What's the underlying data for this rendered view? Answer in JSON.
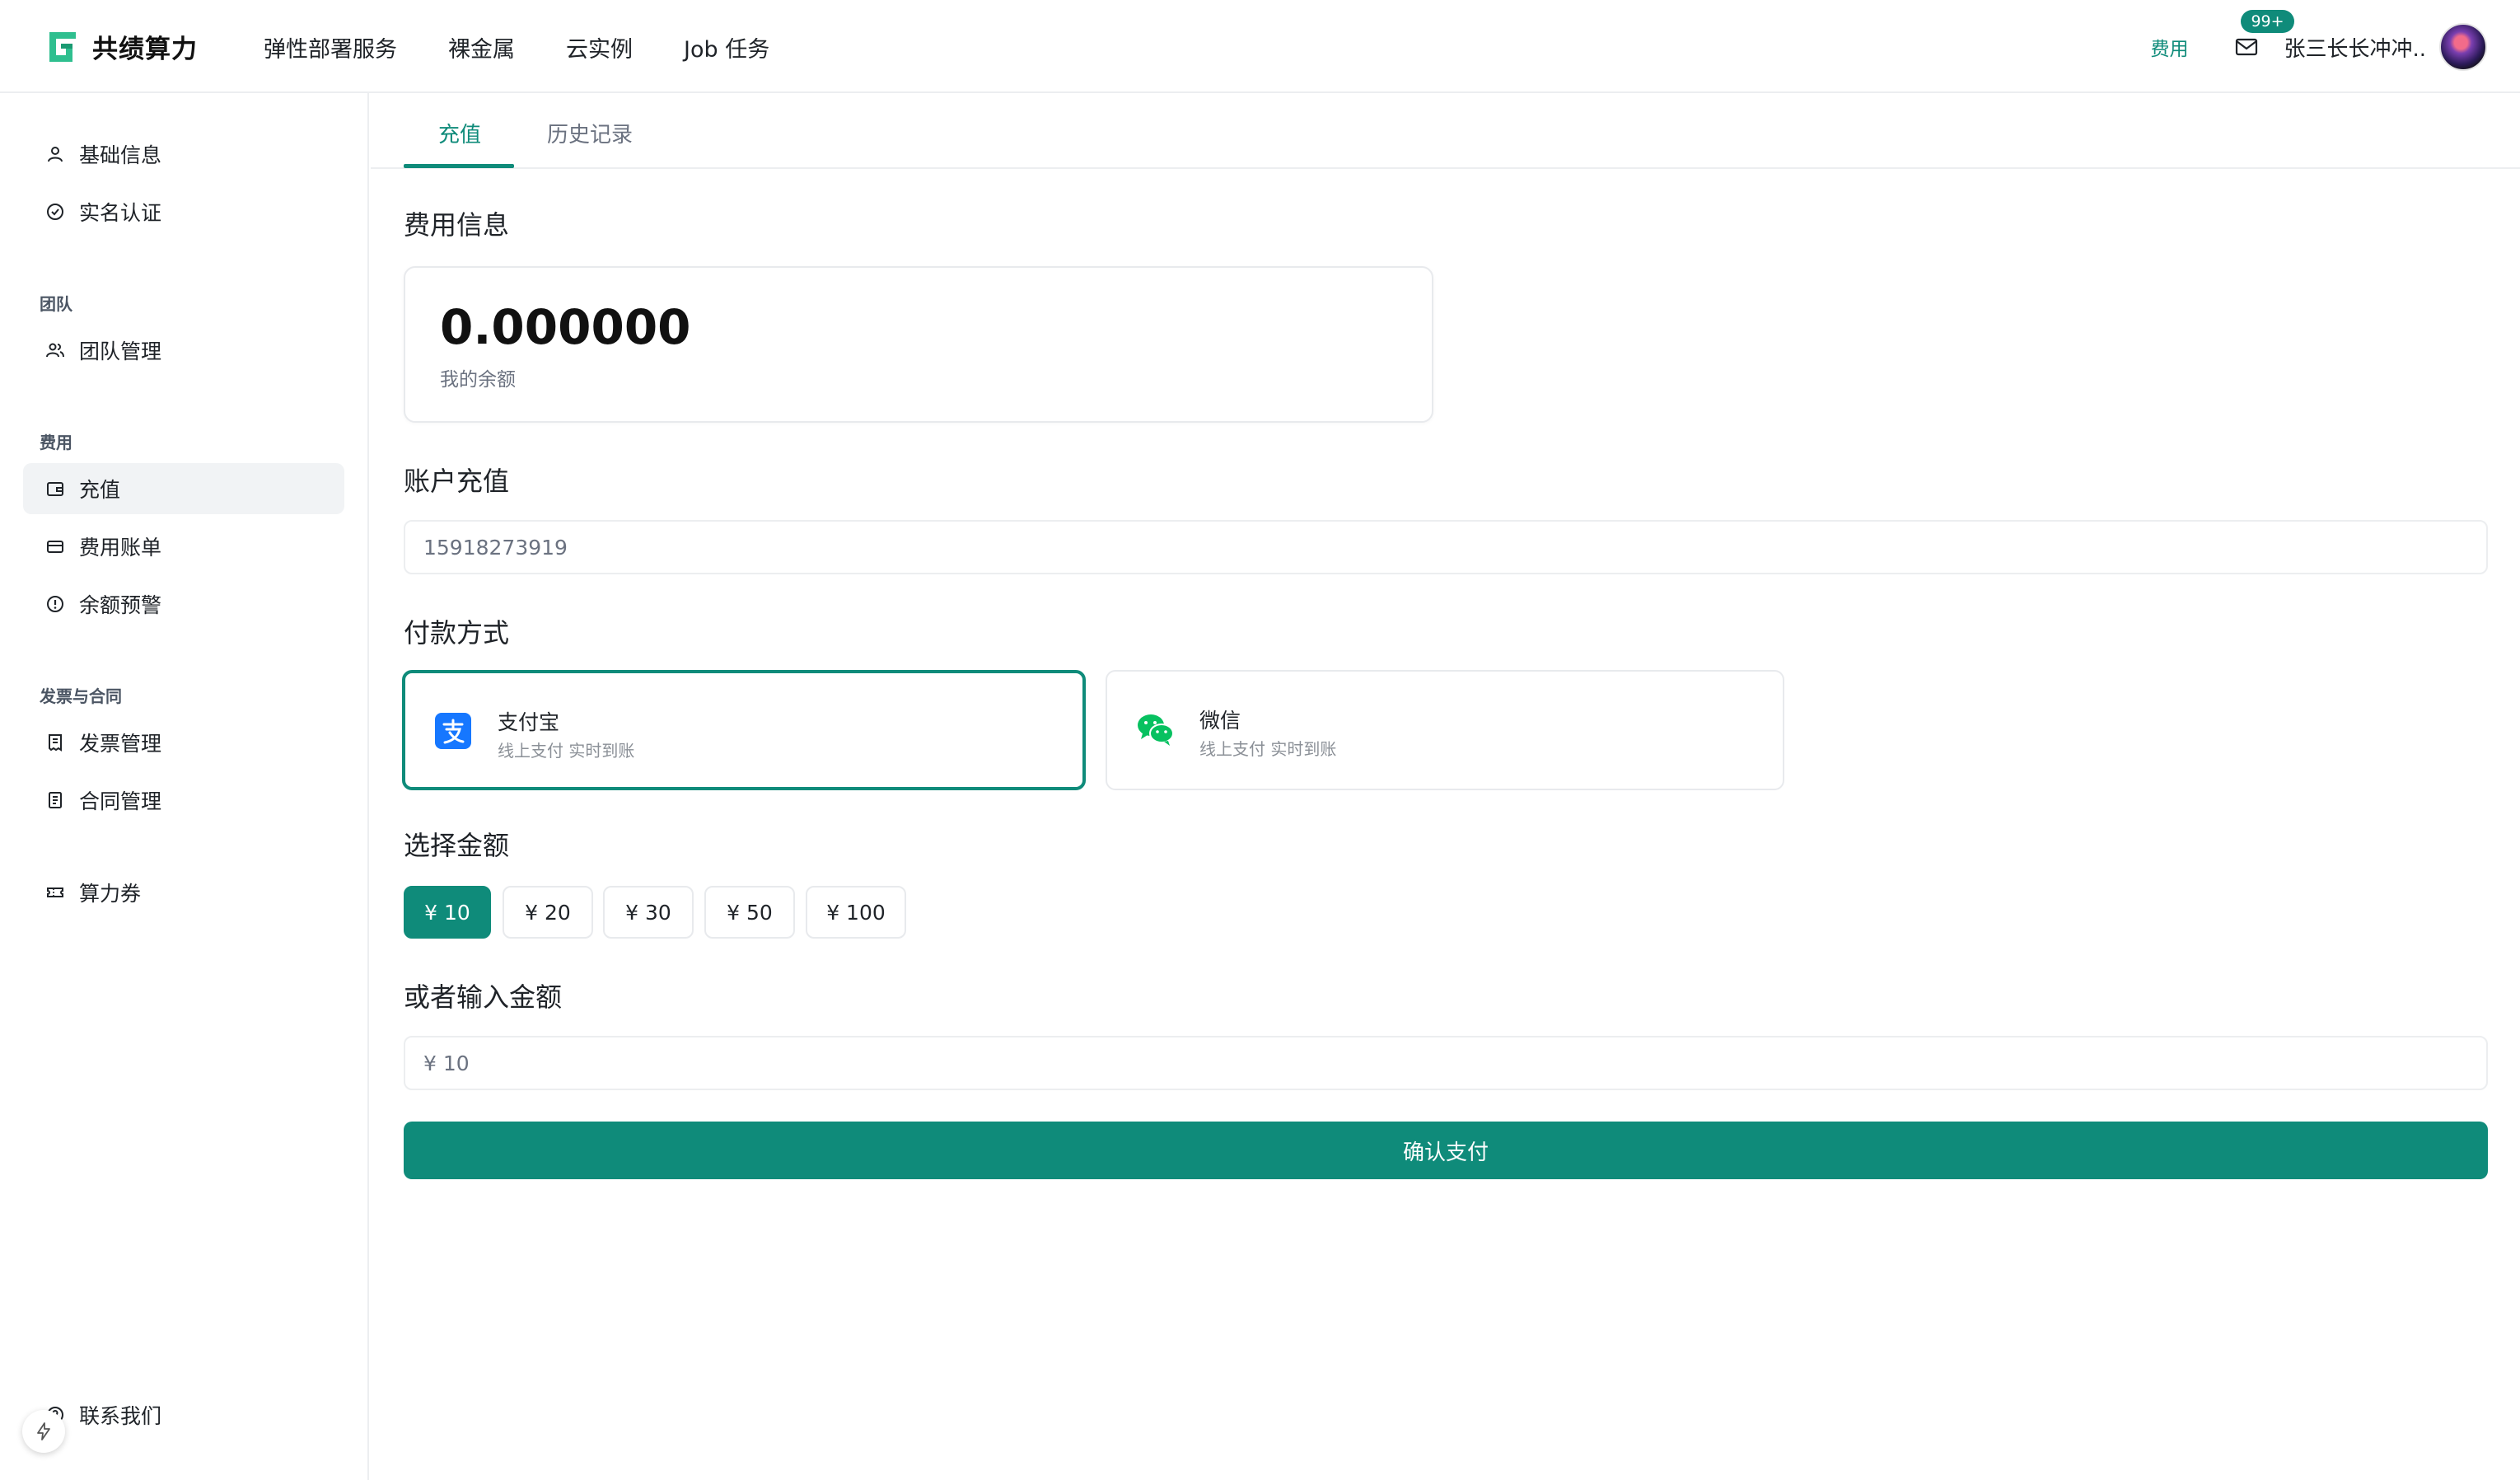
{
  "app": {
    "name": "共绩算力"
  },
  "nav": {
    "items": [
      "弹性部署服务",
      "裸金属",
      "云实例",
      "Job 任务"
    ]
  },
  "header": {
    "fee_link": "费用",
    "notification_count": "99+",
    "username": "张三长长冲冲.."
  },
  "sidebar": {
    "items": [
      {
        "label": "基础信息",
        "icon": "user-icon"
      },
      {
        "label": "实名认证",
        "icon": "check-circle-icon"
      },
      {
        "label": "团队管理",
        "icon": "users-icon"
      },
      {
        "label": "充值",
        "icon": "wallet-icon"
      },
      {
        "label": "费用账单",
        "icon": "card-icon"
      },
      {
        "label": "余额预警",
        "icon": "alert-circle-icon"
      },
      {
        "label": "发票管理",
        "icon": "invoice-icon"
      },
      {
        "label": "合同管理",
        "icon": "document-icon"
      },
      {
        "label": "算力券",
        "icon": "ticket-icon"
      },
      {
        "label": "联系我们",
        "icon": "help-circle-icon"
      }
    ],
    "groups": [
      "团队",
      "费用",
      "发票与合同"
    ]
  },
  "tabs": [
    "充值",
    "历史记录"
  ],
  "fee_info": {
    "title": "费用信息",
    "balance": "0.000000",
    "balance_label": "我的余额"
  },
  "recharge": {
    "title": "账户充值",
    "account_value": "15918273919"
  },
  "payment": {
    "title": "付款方式",
    "methods": [
      {
        "name": "支付宝",
        "desc": "线上支付 实时到账",
        "icon": "alipay-icon",
        "color": "#1677ff"
      },
      {
        "name": "微信",
        "desc": "线上支付 实时到账",
        "icon": "wechat-icon",
        "color": "#07c160"
      }
    ]
  },
  "amount": {
    "title": "选择金额",
    "options": [
      "¥ 10",
      "¥ 20",
      "¥ 30",
      "¥ 50",
      "¥ 100"
    ]
  },
  "custom_amount": {
    "title": "或者输入金额",
    "value": "¥ 10"
  },
  "confirm": {
    "label": "确认支付"
  },
  "colors": {
    "accent": "#0f8b7a"
  }
}
